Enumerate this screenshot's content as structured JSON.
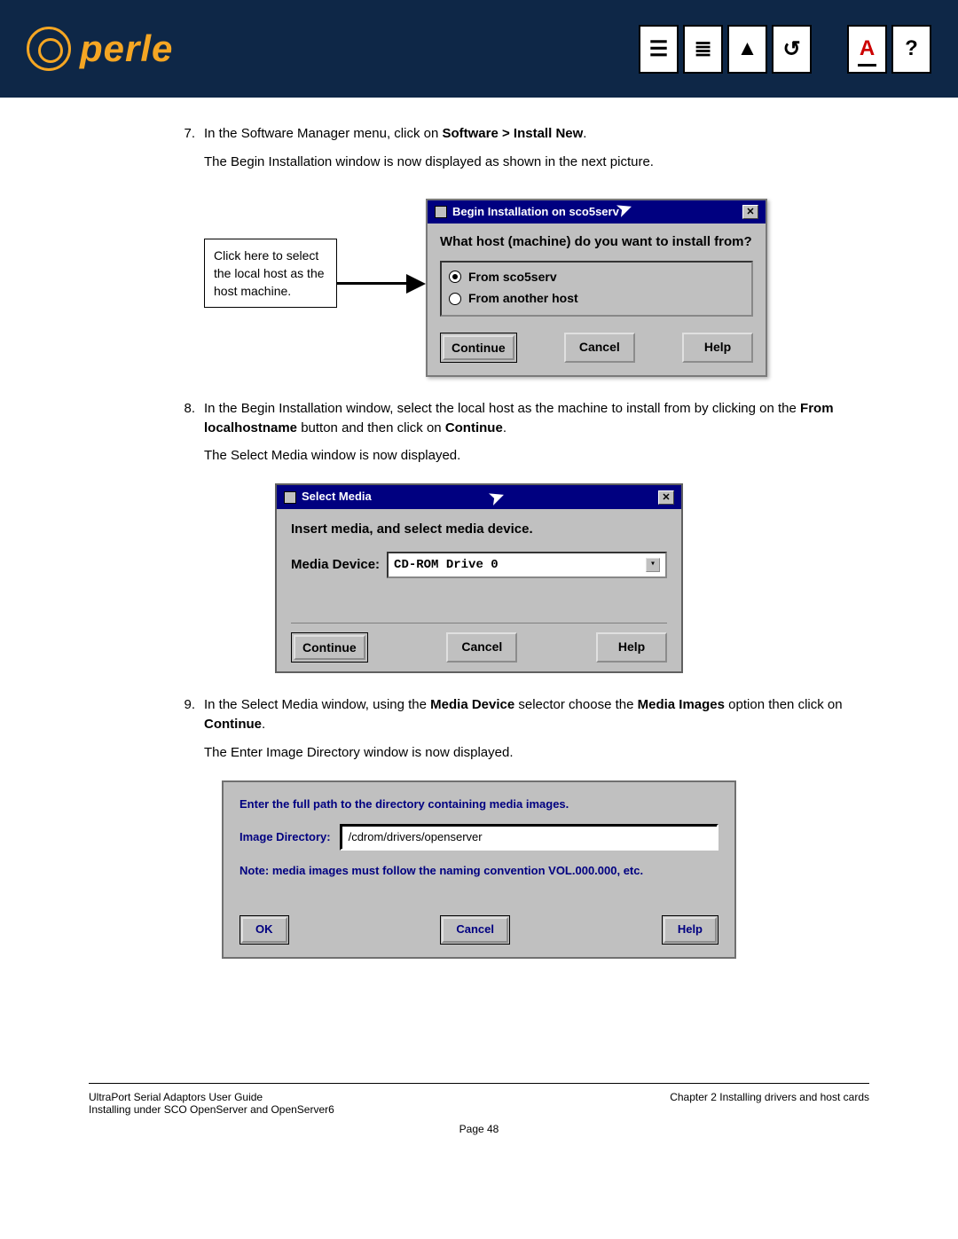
{
  "header": {
    "brand": "perle"
  },
  "step7": {
    "num": "7.",
    "text_a": "In the Software Manager menu, click on ",
    "bold_a": "Software > Install New",
    "text_b": ".",
    "para2": "The Begin Installation window is now displayed as shown in the next picture."
  },
  "callout": "Click here to select the local host as the host machine.",
  "dlg1": {
    "title": "Begin Installation on sco5serv",
    "question": "What host (machine) do you want to install from?",
    "opt1": "From sco5serv",
    "opt2": "From another host",
    "btn1": "Continue",
    "btn2": "Cancel",
    "btn3": "Help"
  },
  "step8": {
    "num": "8.",
    "text_a": "In the Begin Installation window, select the local host as the machine to install from by clicking on the ",
    "bold_a": "From localhostname",
    "text_b": " button and then click on ",
    "bold_b": "Continue",
    "text_c": ".",
    "para2": "The Select Media window is now displayed."
  },
  "dlg2": {
    "title": "Select Media",
    "prompt": "Insert media, and select media device.",
    "label": "Media Device:",
    "value": "CD-ROM Drive 0",
    "btn1": "Continue",
    "btn2": "Cancel",
    "btn3": "Help"
  },
  "step9": {
    "num": "9.",
    "text_a": "In the Select Media window, using the ",
    "bold_a": "Media Device",
    "text_b": " selector choose the ",
    "bold_b": "Media Images",
    "text_c": " option then click on ",
    "bold_c": "Continue",
    "text_d": ".",
    "para2": "The Enter Image Directory window is now displayed."
  },
  "dlg3": {
    "prompt": "Enter the full path to the directory containing media images.",
    "label": "Image Directory:",
    "value": "/cdrom/drivers/openserver",
    "note": "Note: media images must follow the naming convention VOL.000.000, etc.",
    "btn1": "OK",
    "btn2": "Cancel",
    "btn3": "Help"
  },
  "footer": {
    "left1": "UltraPort Serial Adaptors User Guide",
    "left2": "Installing under SCO OpenServer and OpenServer6",
    "right": "Chapter 2 Installing drivers and host cards",
    "page": "Page 48"
  }
}
